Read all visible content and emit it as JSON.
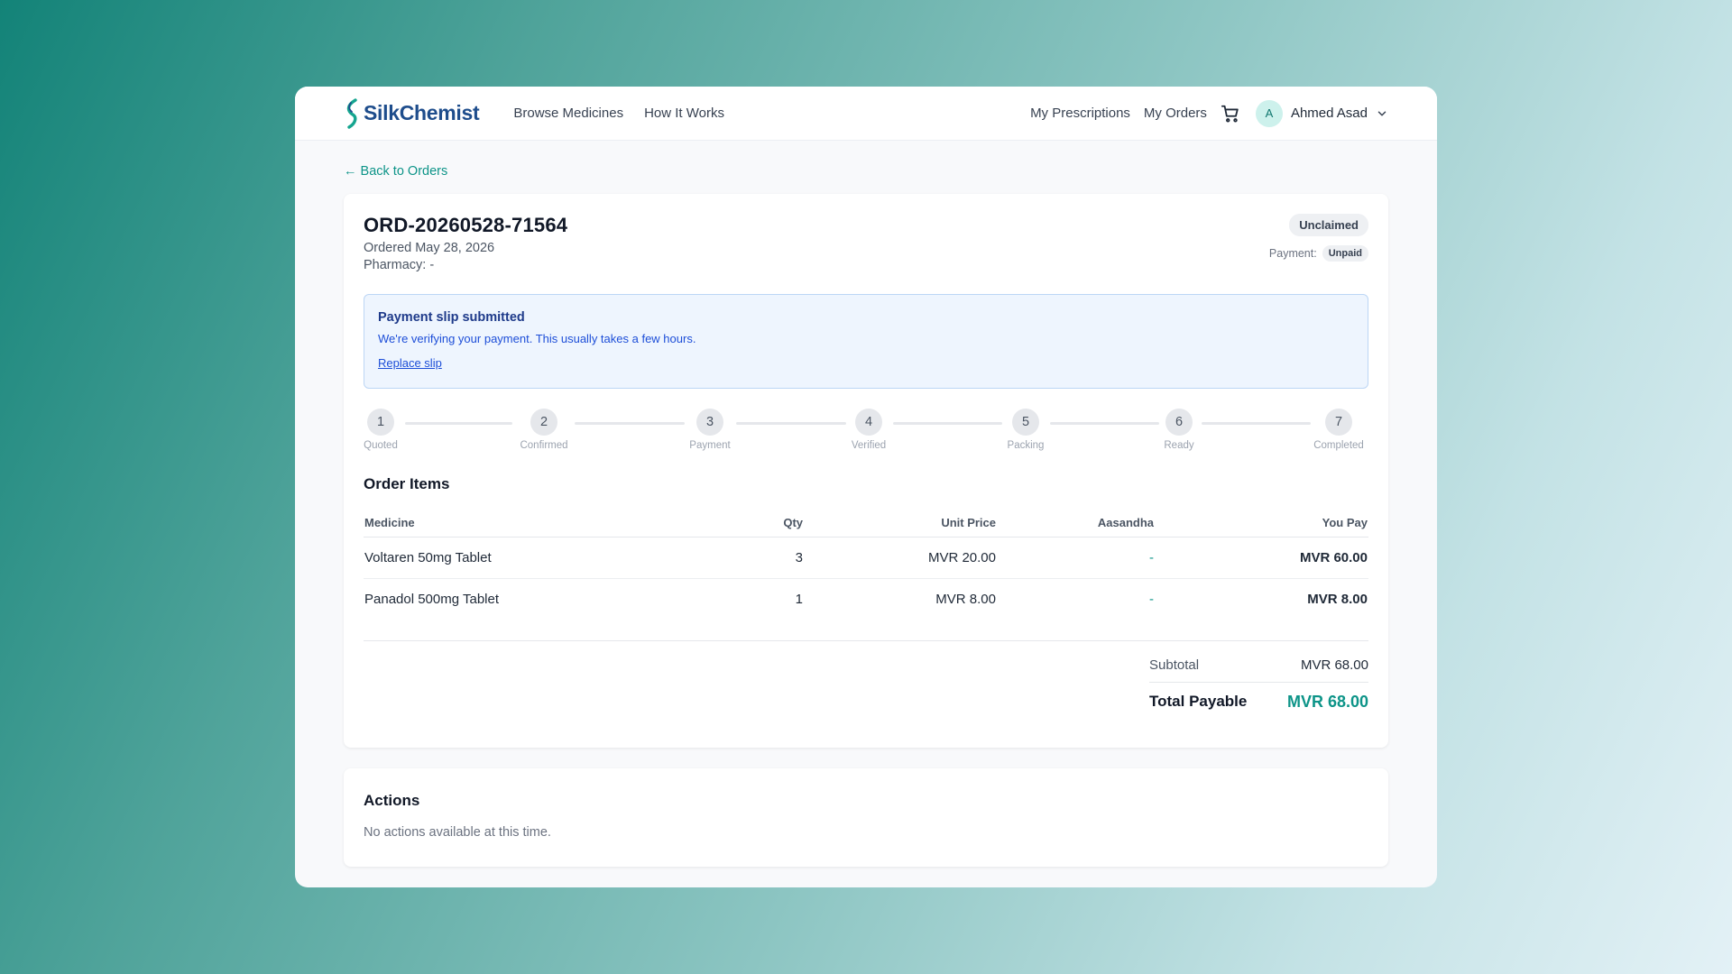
{
  "navbar": {
    "brand": "SilkChemist",
    "links": [
      "Browse Medicines",
      "How It Works"
    ],
    "my_prescriptions": "My Prescriptions",
    "my_orders": "My Orders",
    "user_initial": "A",
    "user_name": "Ahmed Asad"
  },
  "back_link": "← Back to Orders",
  "order": {
    "id": "ORD-20260528-71564",
    "ordered": "Ordered May 28, 2026",
    "pharmacy": "Pharmacy: -",
    "status": "Unclaimed",
    "payment_label": "Payment:",
    "payment_status": "Unpaid"
  },
  "notice": {
    "title": "Payment slip submitted",
    "message": "We're verifying your payment. This usually takes a few hours.",
    "link": "Replace slip"
  },
  "steps": [
    {
      "num": "1",
      "label": "Quoted"
    },
    {
      "num": "2",
      "label": "Confirmed"
    },
    {
      "num": "3",
      "label": "Payment"
    },
    {
      "num": "4",
      "label": "Verified"
    },
    {
      "num": "5",
      "label": "Packing"
    },
    {
      "num": "6",
      "label": "Ready"
    },
    {
      "num": "7",
      "label": "Completed"
    }
  ],
  "items": {
    "title": "Order Items",
    "columns": [
      "Medicine",
      "Qty",
      "Unit Price",
      "Aasandha",
      "You Pay"
    ],
    "rows": [
      {
        "medicine": "Voltaren 50mg Tablet",
        "qty": "3",
        "unit_price": "MVR 20.00",
        "aasandha": "-",
        "you_pay": "MVR 60.00"
      },
      {
        "medicine": "Panadol 500mg Tablet",
        "qty": "1",
        "unit_price": "MVR 8.00",
        "aasandha": "-",
        "you_pay": "MVR 8.00"
      }
    ]
  },
  "summary": {
    "subtotal_label": "Subtotal",
    "subtotal_value": "MVR 68.00",
    "total_label": "Total Payable",
    "total_value": "MVR 68.00"
  },
  "actions": {
    "title": "Actions",
    "empty": "No actions available at this time."
  },
  "colors": {
    "accent": "#0d9488",
    "brand": "#1e4d8c",
    "notice_bg": "#eef5fe"
  }
}
